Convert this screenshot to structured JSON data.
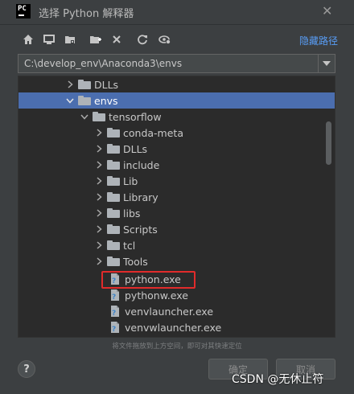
{
  "window": {
    "title": "选择 Python 解释器",
    "logo_text": "PC"
  },
  "toolbar": {
    "icons": [
      "home-icon",
      "desktop-icon",
      "project-folder-icon",
      "new-folder-icon",
      "delete-icon",
      "refresh-icon",
      "show-hidden-icon"
    ],
    "hide_path_label": "隐藏路径"
  },
  "path": {
    "value": "C:\\develop_env\\Anaconda3\\envs"
  },
  "tree": {
    "items": [
      {
        "label": "DLLs",
        "type": "folder",
        "expanded": false
      },
      {
        "label": "envs",
        "type": "folder",
        "expanded": true,
        "selected": true
      },
      {
        "label": "tensorflow",
        "type": "folder",
        "expanded": true
      },
      {
        "label": "conda-meta",
        "type": "folder",
        "expanded": false
      },
      {
        "label": "DLLs",
        "type": "folder",
        "expanded": false
      },
      {
        "label": "include",
        "type": "folder",
        "expanded": false
      },
      {
        "label": "Lib",
        "type": "folder",
        "expanded": false
      },
      {
        "label": "Library",
        "type": "folder",
        "expanded": false
      },
      {
        "label": "libs",
        "type": "folder",
        "expanded": false
      },
      {
        "label": "Scripts",
        "type": "folder",
        "expanded": false
      },
      {
        "label": "tcl",
        "type": "folder",
        "expanded": false
      },
      {
        "label": "Tools",
        "type": "folder",
        "expanded": false
      },
      {
        "label": "python.exe",
        "type": "file",
        "highlighted": true
      },
      {
        "label": "pythonw.exe",
        "type": "file"
      },
      {
        "label": "venvlauncher.exe",
        "type": "file"
      },
      {
        "label": "venvwlauncher.exe",
        "type": "file"
      }
    ]
  },
  "hint": "将文件拖放到上方空间，即可对其快速定位",
  "buttons": {
    "help": "?",
    "ok": "确定",
    "cancel": "取消"
  },
  "watermark": "CSDN @无休止符",
  "colors": {
    "selection": "#4b6eaf",
    "highlight_border": "#e12b2b",
    "link": "#589df6"
  }
}
